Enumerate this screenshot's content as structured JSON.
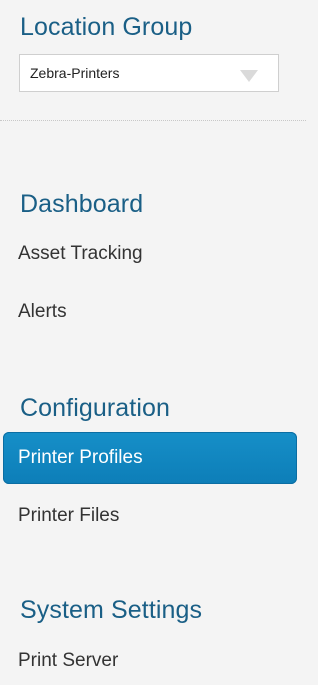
{
  "location_group": {
    "title": "Location Group",
    "selected": "Zebra-Printers"
  },
  "sections": {
    "dashboard": {
      "title": "Dashboard",
      "items": [
        "Asset Tracking",
        "Alerts"
      ]
    },
    "configuration": {
      "title": "Configuration",
      "items": [
        "Printer Profiles",
        "Printer Files"
      ]
    },
    "system_settings": {
      "title": "System Settings",
      "items": [
        "Print Server"
      ]
    }
  },
  "colors": {
    "accent": "#168fc8",
    "heading": "#1a5f86",
    "background": "#f4f4f4"
  }
}
